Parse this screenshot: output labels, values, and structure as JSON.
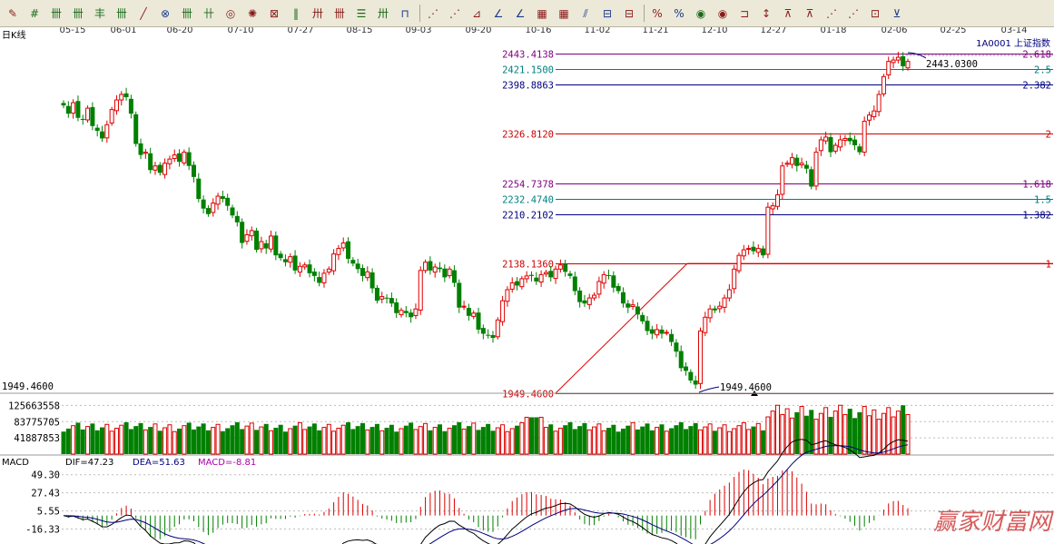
{
  "toolbar": {
    "buttons": [
      {
        "name": "pencil-icon",
        "glyph": "✎",
        "color": "red"
      },
      {
        "name": "grid-lines-icon",
        "glyph": "#",
        "color": "green"
      },
      {
        "name": "fence-1-icon",
        "glyph": "卌",
        "color": "green"
      },
      {
        "name": "fence-2-icon",
        "glyph": "卌",
        "color": "green"
      },
      {
        "name": "fence-3-icon",
        "glyph": "丰",
        "color": "green"
      },
      {
        "name": "fence-4-icon",
        "glyph": "卌",
        "color": "green"
      },
      {
        "name": "ruler-icon",
        "glyph": "╱",
        "color": "red"
      },
      {
        "name": "circle-grid-icon",
        "glyph": "⊗",
        "color": "blue"
      },
      {
        "name": "hash-1-icon",
        "glyph": "卌",
        "color": "green"
      },
      {
        "name": "hash-2-icon",
        "glyph": "卄",
        "color": "green"
      },
      {
        "name": "ring-icon",
        "glyph": "◎",
        "color": "red"
      },
      {
        "name": "sun-icon",
        "glyph": "✺",
        "color": "red"
      },
      {
        "name": "box-grid-icon",
        "glyph": "⊠",
        "color": "red"
      },
      {
        "name": "bars-1-icon",
        "glyph": "‖",
        "color": "green"
      },
      {
        "name": "bars-2-icon",
        "glyph": "卅",
        "color": "red"
      },
      {
        "name": "bars-3-icon",
        "glyph": "卌",
        "color": "red"
      },
      {
        "name": "list-1-icon",
        "glyph": "☰",
        "color": "green"
      },
      {
        "name": "list-2-icon",
        "glyph": "卅",
        "color": "green"
      },
      {
        "name": "square-bracket-icon",
        "glyph": "⊓",
        "color": "blue"
      },
      {
        "name": "fan-1-icon",
        "glyph": "⋰",
        "color": "red"
      },
      {
        "name": "fan-2-icon",
        "glyph": "⋰",
        "color": "red"
      },
      {
        "name": "fan-3-icon",
        "glyph": "⊿",
        "color": "red"
      },
      {
        "name": "angle-1-icon",
        "glyph": "∠",
        "color": "blue"
      },
      {
        "name": "angle-2-icon",
        "glyph": "∠",
        "color": "blue"
      },
      {
        "name": "grid-square-1-icon",
        "glyph": "▦",
        "color": "red"
      },
      {
        "name": "grid-square-2-icon",
        "glyph": "▦",
        "color": "red"
      },
      {
        "name": "diagonal-lines-icon",
        "glyph": "⫽",
        "color": "blue"
      },
      {
        "name": "ladder-1-icon",
        "glyph": "⊟",
        "color": "blue"
      },
      {
        "name": "ladder-2-icon",
        "glyph": "⊟",
        "color": "red"
      },
      {
        "name": "percent-1-icon",
        "glyph": "%",
        "color": "red"
      },
      {
        "name": "percent-2-icon",
        "glyph": "%",
        "color": "blue"
      },
      {
        "name": "coin-1-icon",
        "glyph": "◉",
        "color": "green"
      },
      {
        "name": "coin-2-icon",
        "glyph": "◉",
        "color": "red"
      },
      {
        "name": "bracket-1-icon",
        "glyph": "⊐",
        "color": "red"
      },
      {
        "name": "arrow-1-icon",
        "glyph": "↕",
        "color": "red"
      },
      {
        "name": "triangle-1-icon",
        "glyph": "⊼",
        "color": "red"
      },
      {
        "name": "triangle-2-icon",
        "glyph": "⊼",
        "color": "red"
      },
      {
        "name": "fan-lines-1-icon",
        "glyph": "⋰",
        "color": "red"
      },
      {
        "name": "fan-lines-2-icon",
        "glyph": "⋰",
        "color": "red"
      },
      {
        "name": "box-1-icon",
        "glyph": "⊡",
        "color": "red"
      },
      {
        "name": "underline-icon",
        "glyph": "⊻",
        "color": "blue"
      }
    ]
  },
  "chart_data": [
    {
      "type": "candlestick",
      "period_label": "日K线",
      "security": "1A0001 上证指数",
      "x_tick_labels": [
        "05-15",
        "06-01",
        "06-20",
        "07-10",
        "07-27",
        "08-15",
        "09-03",
        "09-20",
        "10-16",
        "11-02",
        "11-21",
        "12-10",
        "12-27",
        "01-18",
        "02-06",
        "02-25",
        "03-14"
      ],
      "ylim": [
        1930,
        2450
      ],
      "grid": false,
      "price_levels": [
        {
          "label": "2443.4138",
          "value": 2443.4138,
          "ratio": "2.618",
          "color": "#800080"
        },
        {
          "label": "2421.1500",
          "value": 2421.15,
          "ratio": "2.5",
          "color": "#008080"
        },
        {
          "label": "2398.8863",
          "value": 2398.8863,
          "ratio": "2.382",
          "color": "#000080"
        },
        {
          "label": "2326.8120",
          "value": 2326.812,
          "ratio": "2",
          "color": "#cc0000"
        },
        {
          "label": "2254.7378",
          "value": 2254.7378,
          "ratio": "1.618",
          "color": "#800080"
        },
        {
          "label": "2232.4740",
          "value": 2232.474,
          "ratio": "1.5",
          "color": "#008080"
        },
        {
          "label": "2210.2102",
          "value": 2210.2102,
          "ratio": "1.382",
          "color": "#000080"
        },
        {
          "label": "2138.1360",
          "value": 2138.136,
          "ratio": "1",
          "color": "#cc0000"
        },
        {
          "label": "1949.4600",
          "value": 1949.46,
          "ratio": "",
          "color": "#cc0000"
        }
      ],
      "annotations": [
        {
          "text": "1949.4600",
          "value": 1949.46
        },
        {
          "text": "2443.0300",
          "value": 2443.03
        }
      ],
      "series_colors": {
        "up": "#dd0000",
        "down": "#008000"
      },
      "closes": [
        2368,
        2356,
        2372,
        2350,
        2347,
        2364,
        2338,
        2331,
        2320,
        2340,
        2362,
        2376,
        2384,
        2380,
        2356,
        2312,
        2296,
        2300,
        2274,
        2280,
        2270,
        2284,
        2290,
        2296,
        2286,
        2300,
        2280,
        2264,
        2232,
        2218,
        2210,
        2226,
        2236,
        2232,
        2222,
        2208,
        2198,
        2168,
        2180,
        2186,
        2158,
        2170,
        2160,
        2178,
        2150,
        2146,
        2140,
        2148,
        2128,
        2134,
        2136,
        2124,
        2120,
        2110,
        2124,
        2130,
        2152,
        2160,
        2168,
        2145,
        2138,
        2130,
        2120,
        2126,
        2102,
        2084,
        2090,
        2088,
        2080,
        2066,
        2070,
        2066,
        2060,
        2072,
        2128,
        2140,
        2128,
        2133,
        2130,
        2118,
        2130,
        2110,
        2074,
        2076,
        2062,
        2066,
        2042,
        2036,
        2034,
        2030,
        2056,
        2084,
        2100,
        2110,
        2106,
        2116,
        2120,
        2120,
        2112,
        2122,
        2125,
        2118,
        2130,
        2136,
        2126,
        2120,
        2098,
        2082,
        2080,
        2088,
        2092,
        2112,
        2122,
        2120,
        2103,
        2098,
        2080,
        2074,
        2078,
        2064,
        2054,
        2040,
        2036,
        2042,
        2036,
        2038,
        2024,
        2010,
        1986,
        1982,
        1968,
        1962,
        2040,
        2060,
        2072,
        2070,
        2076,
        2088,
        2100,
        2130,
        2150,
        2158,
        2160,
        2156,
        2160,
        2150,
        2220,
        2222,
        2238,
        2280,
        2284,
        2292,
        2280,
        2284,
        2276,
        2250,
        2300,
        2318,
        2322,
        2300,
        2310,
        2318,
        2320,
        2316,
        2310,
        2300,
        2345,
        2354,
        2360,
        2384,
        2410,
        2432,
        2434,
        2438,
        2425,
        2432
      ],
      "volume_axis_labels": [
        {
          "text": "125663558",
          "value": 125663558
        },
        {
          "text": "83775705",
          "value": 83775705
        },
        {
          "text": "41887853",
          "value": 41887853
        }
      ]
    },
    {
      "type": "line",
      "panel": "MACD",
      "indicator_name": "MACD",
      "readouts": [
        {
          "text": "DIF=47.23",
          "color": "#000000"
        },
        {
          "text": "DEA=51.63",
          "color": "#000080"
        },
        {
          "text": "MACD=-8.81",
          "color": "#aa00aa"
        }
      ],
      "y_tick_labels": [
        "49.30",
        "27.43",
        "5.55",
        "-16.33"
      ],
      "y_ticks": [
        49.3,
        27.43,
        5.55,
        -16.33
      ],
      "ylim": [
        -30,
        60
      ]
    }
  ],
  "watermark": "赢家财富网"
}
